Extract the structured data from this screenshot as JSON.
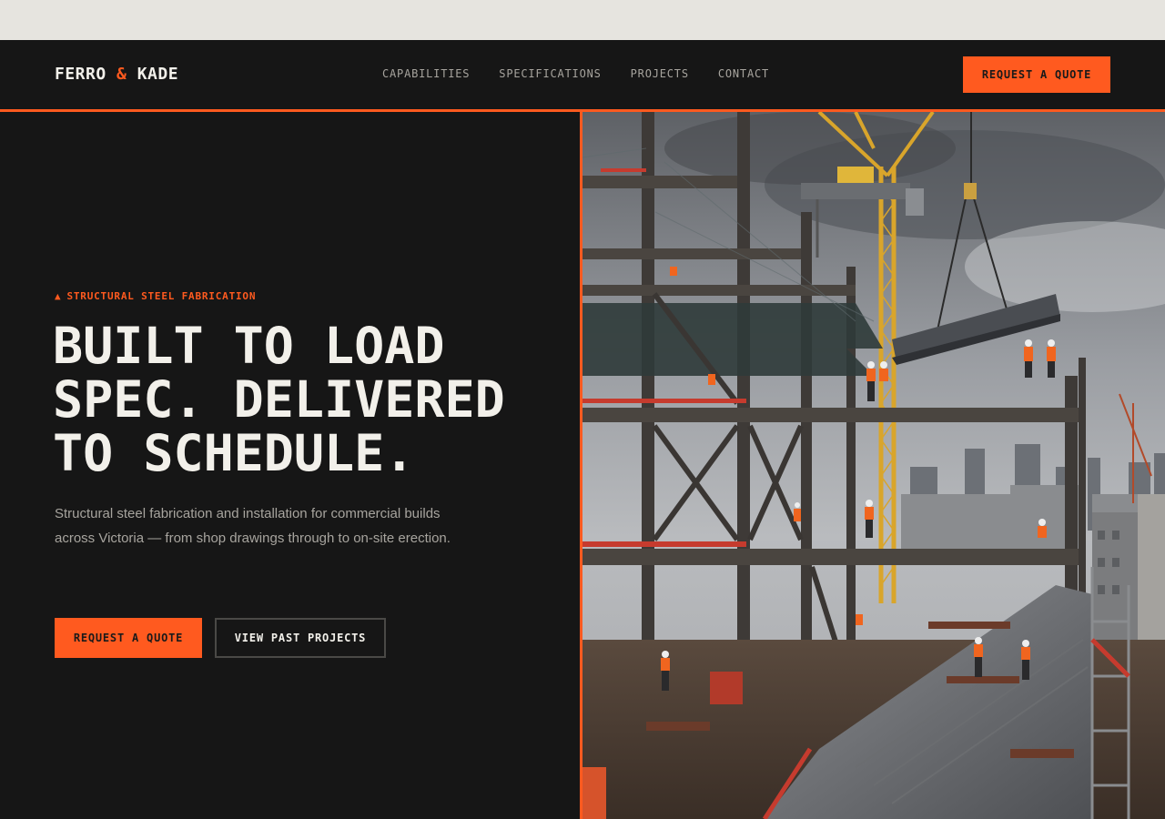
{
  "brand": {
    "name_left": "FERRO",
    "name_amp": "&",
    "name_right": "KADE"
  },
  "nav": {
    "items": [
      {
        "label": "CAPABILITIES"
      },
      {
        "label": "SPECIFICATIONS"
      },
      {
        "label": "PROJECTS"
      },
      {
        "label": "CONTACT"
      }
    ],
    "cta_label": "REQUEST A QUOTE"
  },
  "hero": {
    "eyebrow_icon": "▲",
    "eyebrow": "STRUCTURAL STEEL FABRICATION",
    "headline_lines": [
      "BUILT TO LOAD",
      "SPEC. DELIVERED",
      "TO SCHEDULE."
    ],
    "lede": "Structural steel fabrication and installation for commercial builds across Victoria — from shop drawings through to on-site erection.",
    "primary_cta": "REQUEST A QUOTE",
    "secondary_cta": "VIEW PAST PROJECTS"
  },
  "colors": {
    "accent": "#ff5a1f",
    "background_dark": "#161616",
    "text_light": "#f2f0ea",
    "text_muted": "#a7a49e"
  }
}
